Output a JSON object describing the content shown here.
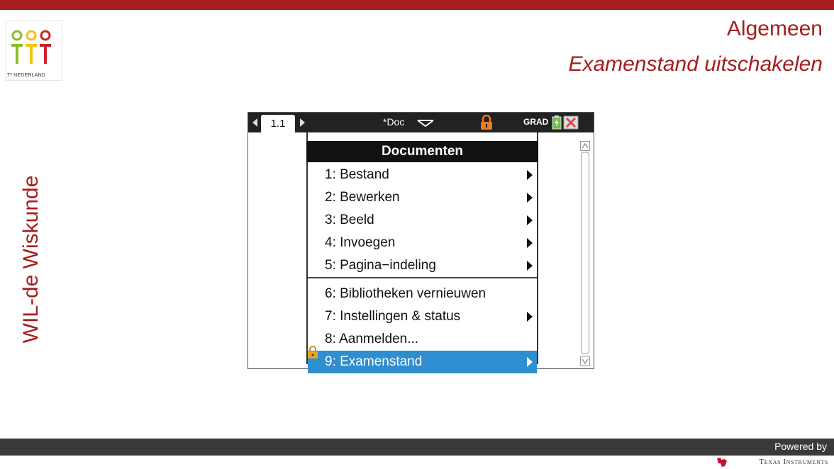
{
  "logo": {
    "caption": "T³ NEDERLAND"
  },
  "header": {
    "title": "Algemeen",
    "subtitle": "Examenstand uitschakelen"
  },
  "side": {
    "label": "WIL-de Wiskunde"
  },
  "calculator": {
    "tab_label": "1.1",
    "document_title": "*Doc",
    "angle_mode": "GRAD",
    "menu": {
      "title": "Documenten",
      "items": [
        {
          "label": "1: Bestand",
          "submenu": true
        },
        {
          "label": "2: Bewerken",
          "submenu": true
        },
        {
          "label": "3: Beeld",
          "submenu": true
        },
        {
          "label": "4: Invoegen",
          "submenu": true
        },
        {
          "label": "5: Pagina−indeling",
          "submenu": true
        },
        {
          "label": "6: Bibliotheken vernieuwen",
          "submenu": false
        },
        {
          "label": "7: Instellingen & status",
          "submenu": true
        },
        {
          "label": "8: Aanmelden...",
          "submenu": false
        },
        {
          "label": "9: Examenstand",
          "submenu": true,
          "selected": true
        }
      ]
    },
    "colors": {
      "selection": "#2f8ecf",
      "lock": "#f07a1a",
      "close": "#e04545"
    }
  },
  "footer": {
    "powered_by": "Powered by",
    "brand": "Texas Instruments"
  },
  "colors": {
    "accent": "#a61d1d",
    "footer_bar": "#3a3a3a"
  }
}
